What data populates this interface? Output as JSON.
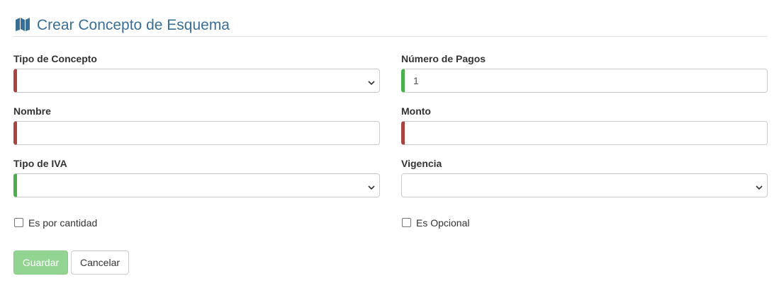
{
  "header": {
    "icon": "map-icon",
    "title": "Crear Concepto de Esquema"
  },
  "form": {
    "tipo_concepto": {
      "label": "Tipo de Concepto",
      "value": "",
      "icon": "chevron-down-icon"
    },
    "numero_pagos": {
      "label": "Número de Pagos",
      "value": "1"
    },
    "nombre": {
      "label": "Nombre",
      "value": ""
    },
    "monto": {
      "label": "Monto",
      "value": ""
    },
    "tipo_iva": {
      "label": "Tipo de IVA",
      "value": "",
      "icon": "chevron-down-icon"
    },
    "vigencia": {
      "label": "Vigencia",
      "value": "",
      "icon": "chevron-down-icon"
    },
    "es_por_cantidad": {
      "label": "Es por cantidad",
      "checked": false
    },
    "es_opcional": {
      "label": "Es Opcional",
      "checked": false
    }
  },
  "buttons": {
    "save_label": "Guardar",
    "cancel_label": "Cancelar"
  },
  "colors": {
    "title": "#3a6f95",
    "invalid": "#a94442",
    "valid": "#4cae4c",
    "save_button": "#92d492"
  }
}
